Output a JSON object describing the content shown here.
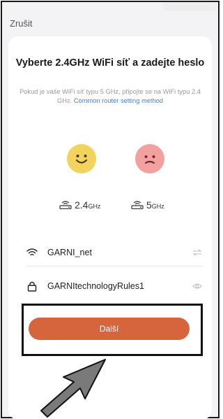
{
  "header": {
    "cancel_label": "Zrušit"
  },
  "main": {
    "title": "Vyberte 2.4GHz WiFi síť a zadejte heslo",
    "subtitle": "Pokud je vaše WiFi síť typu 5 GHz, připojte se na WiFi typu 2.4 GHz.",
    "help_link": "Common router setting method"
  },
  "bands": [
    {
      "number": "2.4",
      "unit": "GHz",
      "state_icon": "happy-face-icon",
      "color": "#f2d35d"
    },
    {
      "number": "5",
      "unit": "GHz",
      "state_icon": "sad-face-icon",
      "color": "#f2a0a0"
    }
  ],
  "form": {
    "ssid_value": "GARNI_net",
    "password_value": "GARNItechnologyRules1",
    "ssid_icon": "wifi-icon",
    "password_icon": "lock-icon",
    "switch_icon": "switch-network-icon",
    "visibility_icon": "eye-icon"
  },
  "actions": {
    "next_label": "Další"
  },
  "colors": {
    "accent": "#d6653e",
    "link": "#4a7fd8"
  }
}
